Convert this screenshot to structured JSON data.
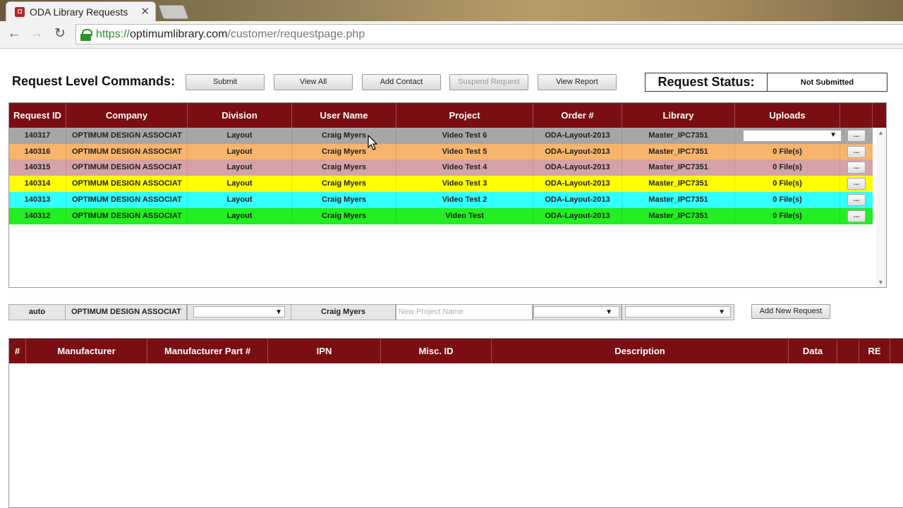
{
  "browser": {
    "tab_title": "ODA Library Requests",
    "tab_close": "✕",
    "favicon": "favicon-icon",
    "url_proto": "https://",
    "url_host": "optimumlibrary.com",
    "url_path": "/customer/requestpage.php"
  },
  "commands": {
    "title": "Request Level Commands:",
    "submit": "Submit",
    "view_all": "View All",
    "add_contact": "Add Contact",
    "suspend_request": "Suspend Request",
    "view_report": "View Report"
  },
  "status": {
    "label": "Request Status:",
    "value": "Not Submitted"
  },
  "requests": {
    "headers": [
      "Request ID",
      "Company",
      "Division",
      "User Name",
      "Project",
      "Order #",
      "Library",
      "Uploads"
    ],
    "rows": [
      {
        "id": "140317",
        "company": "OPTIMUM DESIGN ASSOCIAT",
        "division": "Layout",
        "user": "Craig Myers",
        "project": "Video Test 6",
        "order": "ODA-Layout-2013",
        "library": "Master_IPC7351",
        "uploads": "",
        "color": "#a6a6a6"
      },
      {
        "id": "140316",
        "company": "OPTIMUM DESIGN ASSOCIAT",
        "division": "Layout",
        "user": "Craig Myers",
        "project": "Video Test 5",
        "order": "ODA-Layout-2013",
        "library": "Master_IPC7351",
        "uploads": "0 File(s)",
        "color": "#f7b46d"
      },
      {
        "id": "140315",
        "company": "OPTIMUM DESIGN ASSOCIAT",
        "division": "Layout",
        "user": "Craig Myers",
        "project": "Video Test 4",
        "order": "ODA-Layout-2013",
        "library": "Master_IPC7351",
        "uploads": "0 File(s)",
        "color": "#d5a3a6"
      },
      {
        "id": "140314",
        "company": "OPTIMUM DESIGN ASSOCIAT",
        "division": "Layout",
        "user": "Craig Myers",
        "project": "Video Test 3",
        "order": "ODA-Layout-2013",
        "library": "Master_IPC7351",
        "uploads": "0 File(s)",
        "color": "#ffff00"
      },
      {
        "id": "140313",
        "company": "OPTIMUM DESIGN ASSOCIAT",
        "division": "Layout",
        "user": "Craig Myers",
        "project": "Video Test 2",
        "order": "ODA-Layout-2013",
        "library": "Master_IPC7351",
        "uploads": "0 File(s)",
        "color": "#33ffff"
      },
      {
        "id": "140312",
        "company": "OPTIMUM DESIGN ASSOCIAT",
        "division": "Layout",
        "user": "Craig Myers",
        "project": "Video Test",
        "order": "ODA-Layout-2013",
        "library": "Master_IPC7351",
        "uploads": "0 File(s)",
        "color": "#22ee22"
      }
    ],
    "row_button": "..."
  },
  "new_request": {
    "id": "auto",
    "company": "OPTIMUM DESIGN ASSOCIAT",
    "user": "Craig Myers",
    "project_placeholder": "New Project Name",
    "add_button": "Add New Request"
  },
  "parts": {
    "headers": [
      "#",
      "Manufacturer",
      "Manufacturer Part #",
      "IPN",
      "Misc. ID",
      "Description",
      "Data",
      "",
      "RE"
    ]
  },
  "colors": {
    "header_bg": "#7a0e13"
  }
}
